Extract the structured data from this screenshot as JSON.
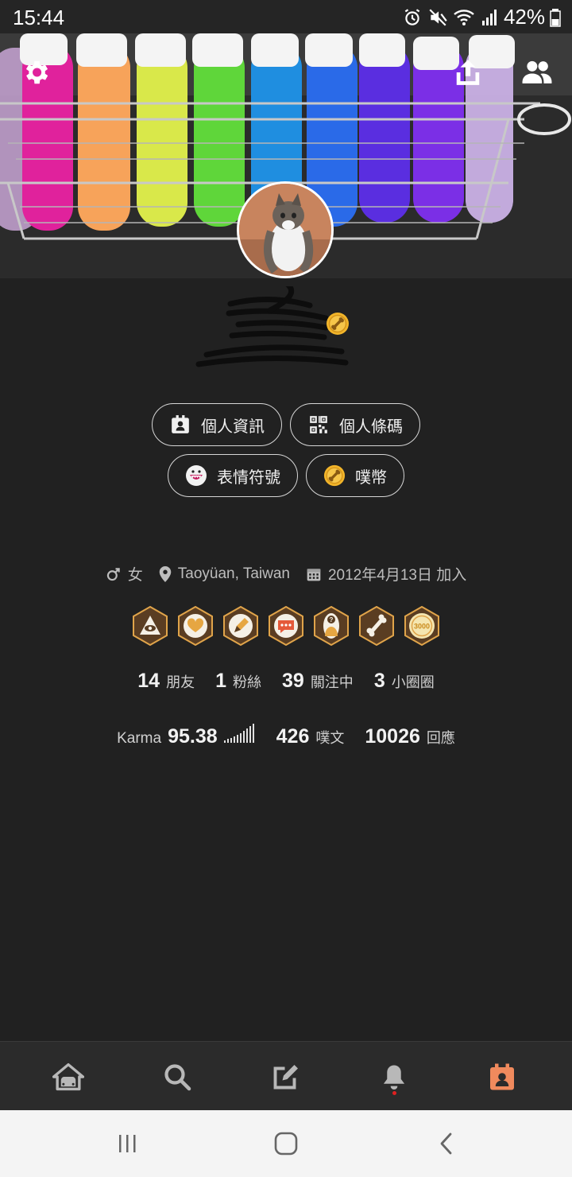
{
  "status_bar": {
    "time": "15:44",
    "battery": "42%"
  },
  "cover": {
    "settings_icon": "gear-icon",
    "share_icon": "share-upload-icon",
    "friends_icon": "people-icon"
  },
  "profile": {
    "avatar_icon": "cat-photo",
    "coin_badge_icon": "coin-badge-icon"
  },
  "actions": [
    {
      "label": "個人資訊",
      "icon": "id-card-icon"
    },
    {
      "label": "個人條碼",
      "icon": "qr-code-icon"
    },
    {
      "label": "表情符號",
      "icon": "emoticon-icon"
    },
    {
      "label": "噗幣",
      "icon": "coin-icon"
    }
  ],
  "meta": {
    "gender": "女",
    "location": "Taoyüan, Taiwan",
    "joined": "2012年4月13日 加入"
  },
  "badges": [
    "eye-badge",
    "heart-badge",
    "pencil-badge",
    "speech-badge",
    "question-person-badge",
    "bone-badge",
    "3000-badge"
  ],
  "badge_3000_text": "3000",
  "stats_row1": [
    {
      "value": "14",
      "label": "朋友"
    },
    {
      "value": "1",
      "label": "粉絲"
    },
    {
      "value": "39",
      "label": "關注中"
    },
    {
      "value": "3",
      "label": "小圈圈"
    }
  ],
  "stats_row2": {
    "karma_label": "Karma",
    "karma_value": "95.38",
    "plurks_value": "426",
    "plurks_label": "噗文",
    "responses_value": "10026",
    "responses_label": "回應"
  },
  "bottom_nav": [
    {
      "icon": "home-icon"
    },
    {
      "icon": "search-icon"
    },
    {
      "icon": "compose-icon"
    },
    {
      "icon": "bell-icon"
    },
    {
      "icon": "profile-card-icon",
      "active": true
    }
  ],
  "colors": {
    "background": "#212121",
    "accent": "#f08a5d",
    "coin": "#f2b52a",
    "badge_bg": "#5a3d22"
  }
}
